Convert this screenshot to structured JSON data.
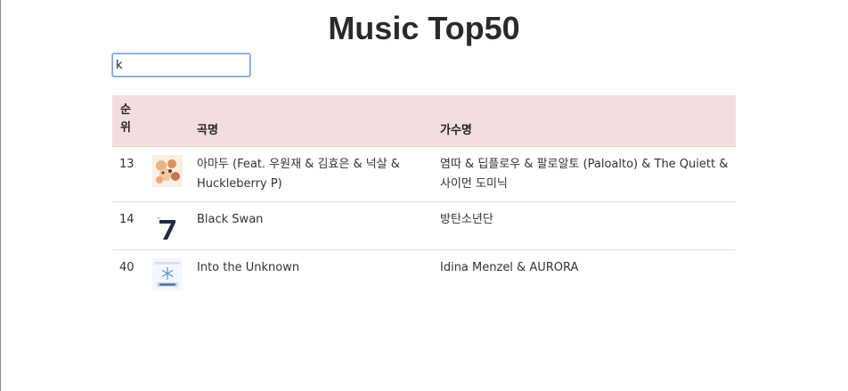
{
  "page": {
    "title": "Music Top50"
  },
  "search": {
    "value": "k"
  },
  "table": {
    "headers": {
      "rank": "순위",
      "title": "곡명",
      "artist": "가수명"
    },
    "rows": [
      {
        "rank": "13",
        "title": "아마두 (Feat. 우원재 & 김효은 & 넉살 & Huckleberry P)",
        "artist": "염따 & 딥플로우 & 팔로알토 (Paloalto) & The Quiett & 사이먼 도미닉",
        "art_icon": "album-art-amadu"
      },
      {
        "rank": "14",
        "title": "Black Swan",
        "artist": "방탄소년단",
        "art_icon": "album-art-map-of-the-soul-7"
      },
      {
        "rank": "40",
        "title": "Into the Unknown",
        "artist": "Idina Menzel & AURORA",
        "art_icon": "album-art-frozen-2"
      }
    ]
  },
  "colors": {
    "header_bg": "#f2dede",
    "input_border": "#7a9fd6"
  }
}
